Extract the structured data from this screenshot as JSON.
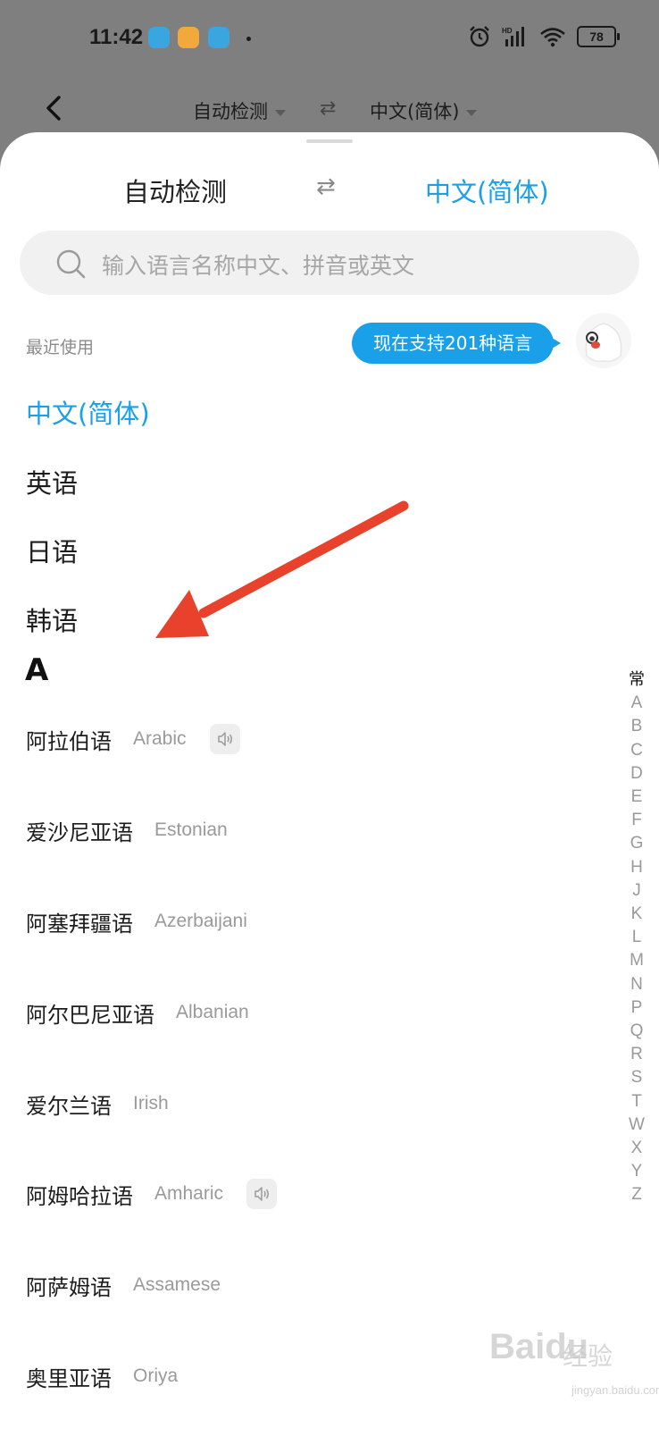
{
  "status_bar": {
    "time": "11:42",
    "battery": "78",
    "signal_label": "HD",
    "app_icon_colors": [
      "#3aa6e0",
      "#f2a93b",
      "#3aa6e0"
    ]
  },
  "background_header": {
    "source_lang": "自动检测",
    "target_lang": "中文(简体)",
    "swap_icon": "swap-arrows-icon"
  },
  "sheet": {
    "source_lang": "自动检测",
    "target_lang": "中文(简体)",
    "swap_icon": "⇄",
    "accent_color": "#1aa0e8"
  },
  "search": {
    "placeholder": "输入语言名称中文、拼音或英文"
  },
  "recent": {
    "heading": "最近使用",
    "tooltip": "现在支持201种语言",
    "items": [
      "中文(简体)",
      "英语",
      "日语",
      "韩语"
    ]
  },
  "section": {
    "letter": "A",
    "languages": [
      {
        "cn": "阿拉伯语",
        "en": "Arabic",
        "speaker": true
      },
      {
        "cn": "爱沙尼亚语",
        "en": "Estonian",
        "speaker": false
      },
      {
        "cn": "阿塞拜疆语",
        "en": "Azerbaijani",
        "speaker": false
      },
      {
        "cn": "阿尔巴尼亚语",
        "en": "Albanian",
        "speaker": false
      },
      {
        "cn": "爱尔兰语",
        "en": "Irish",
        "speaker": false
      },
      {
        "cn": "阿姆哈拉语",
        "en": "Amharic",
        "speaker": true
      },
      {
        "cn": "阿萨姆语",
        "en": "Assamese",
        "speaker": false
      },
      {
        "cn": "奥里亚语",
        "en": "Oriya",
        "speaker": false
      }
    ]
  },
  "index": [
    "常",
    "A",
    "B",
    "C",
    "D",
    "E",
    "F",
    "G",
    "H",
    "J",
    "K",
    "L",
    "M",
    "N",
    "P",
    "Q",
    "R",
    "S",
    "T",
    "W",
    "X",
    "Y",
    "Z"
  ],
  "watermark": {
    "brand": "Baidu",
    "cn": "经验",
    "url": "jingyan.baidu.com"
  },
  "annotation_color": "#e8412c"
}
